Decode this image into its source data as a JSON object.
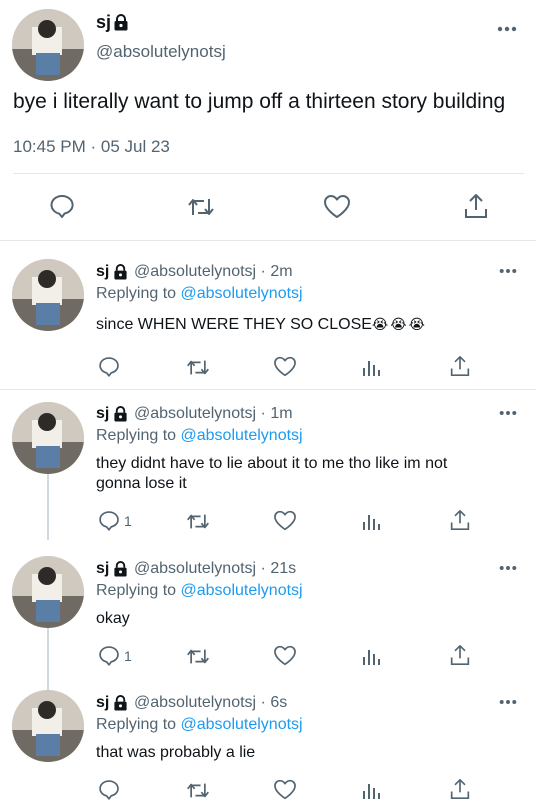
{
  "main_tweet": {
    "name": "sj",
    "handle": "@absolutelynotsj",
    "text": "bye i literally want to jump off a thirteen story building",
    "timestamp": "10:45 PM · 05 Jul 23"
  },
  "replies": [
    {
      "name": "sj",
      "handle": "@absolutelynotsj",
      "time": "· 2m",
      "replying_prefix": "Replying to",
      "replying_to": "@absolutelynotsj",
      "text": "since WHEN WERE THEY SO CLOSE",
      "emoji": "😭😭😭",
      "reply_count": ""
    },
    {
      "name": "sj",
      "handle": "@absolutelynotsj",
      "time": "· 1m",
      "replying_prefix": "Replying to",
      "replying_to": "@absolutelynotsj",
      "text_line1": "they didnt have to lie about it to me tho like im not",
      "text_line2": "gonna lose it",
      "reply_count": "1"
    },
    {
      "name": "sj",
      "handle": "@absolutelynotsj",
      "time": "· 21s",
      "replying_prefix": "Replying to",
      "replying_to": "@absolutelynotsj",
      "text": "okay",
      "reply_count": "1"
    },
    {
      "name": "sj",
      "handle": "@absolutelynotsj",
      "time": "· 6s",
      "replying_prefix": "Replying to",
      "replying_to": "@absolutelynotsj",
      "text": "that was probably a lie",
      "reply_count": ""
    }
  ],
  "colors": {
    "link": "#1d9bf0",
    "muted": "#536471",
    "text": "#0f1419",
    "divider": "#e7e7e7"
  },
  "icons": [
    "lock-icon",
    "more-icon",
    "reply-icon",
    "retweet-icon",
    "like-icon",
    "views-icon",
    "share-icon"
  ]
}
